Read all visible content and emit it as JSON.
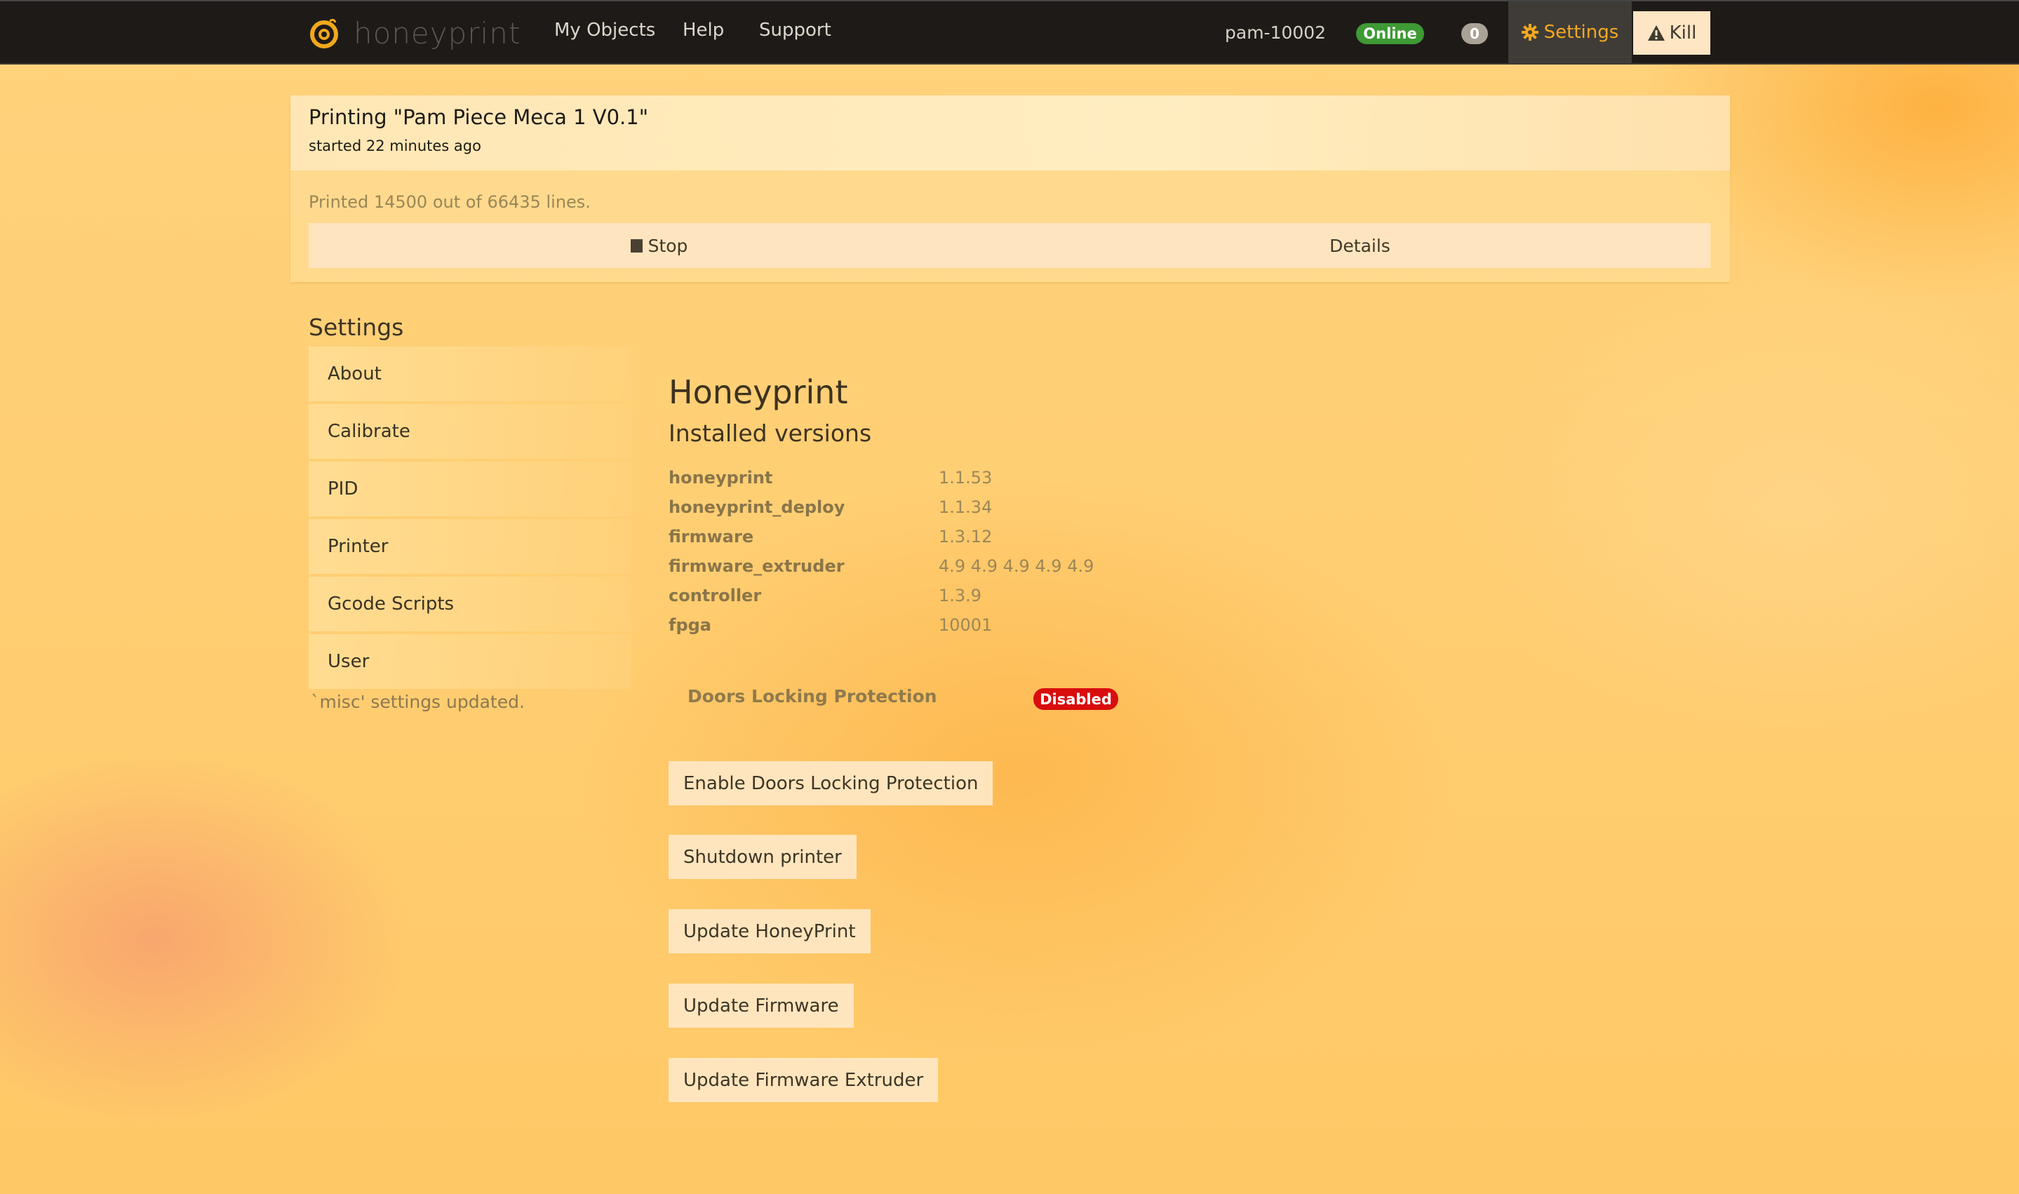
{
  "navbar": {
    "brand": "honeyprint",
    "links": [
      {
        "label": "My Objects"
      },
      {
        "label": "Help"
      },
      {
        "label": "Support"
      }
    ],
    "printer_name": "pam-10002",
    "status_badge": "Online",
    "notification_count": "0",
    "settings_label": "Settings",
    "kill_label": "Kill",
    "colors": {
      "online": "#3e9a34",
      "settings_active": "#f3a81f",
      "navbar_bg": "#1e1a17"
    }
  },
  "print_job": {
    "title": "Printing \"Pam Piece Meca 1 V0.1\"",
    "started": "started 22 minutes ago",
    "progress_text": "Printed 14500 out of 66435 lines.",
    "lines_printed": 14500,
    "lines_total": 66435,
    "stop_label": "Stop",
    "details_label": "Details"
  },
  "settings": {
    "heading": "Settings",
    "menu": [
      {
        "label": "About"
      },
      {
        "label": "Calibrate"
      },
      {
        "label": "PID"
      },
      {
        "label": "Printer"
      },
      {
        "label": "Gcode Scripts"
      },
      {
        "label": "User"
      }
    ],
    "status_message": "`misc' settings updated."
  },
  "about": {
    "title": "Honeyprint",
    "subtitle": "Installed versions",
    "versions": [
      {
        "name": "honeyprint",
        "version": "1.1.53"
      },
      {
        "name": "honeyprint_deploy",
        "version": "1.1.34"
      },
      {
        "name": "firmware",
        "version": "1.3.12"
      },
      {
        "name": "firmware_extruder",
        "version": "4.9 4.9 4.9 4.9 4.9"
      },
      {
        "name": "controller",
        "version": "1.3.9"
      },
      {
        "name": "fpga",
        "version": "10001"
      }
    ],
    "doors_locking": {
      "label": "Doors Locking Protection",
      "status": "Disabled",
      "status_color": "#d90d0d"
    },
    "actions": [
      {
        "label": "Enable Doors Locking Protection"
      },
      {
        "label": "Shutdown printer"
      },
      {
        "label": "Update HoneyPrint"
      },
      {
        "label": "Update Firmware"
      },
      {
        "label": "Update Firmware Extruder"
      }
    ]
  }
}
